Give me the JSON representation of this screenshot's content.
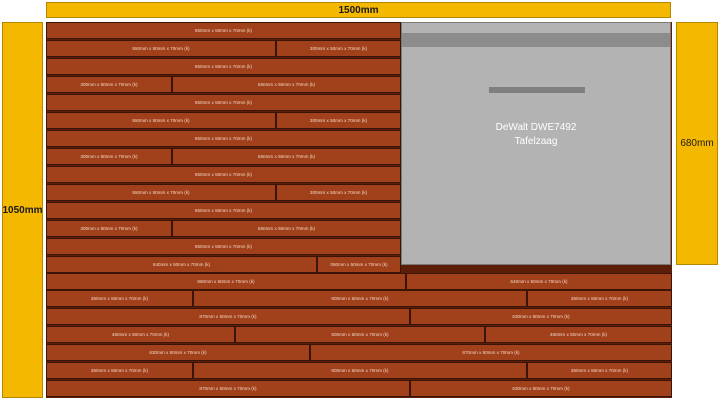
{
  "dimensions": {
    "width": "1500mm",
    "height": "1050mm",
    "table_saw_depth": "680mm"
  },
  "table_saw": {
    "line1": "DeWalt DWE7492",
    "line2": "Tafelzaag"
  },
  "rows": [
    [
      "850mm x 50mm x 70mm (k)"
    ],
    [
      "550mm x 50mm x 70mm (k)",
      "300mm x 50mm x 70mm (k)"
    ],
    [
      "850mm x 50mm x 70mm (k)"
    ],
    [
      "300mm x 50mm x 70mm (k)",
      "550mm x 50mm x 70mm (k)"
    ],
    [
      "850mm x 50mm x 70mm (k)"
    ],
    [
      "550mm x 50mm x 70mm (k)",
      "300mm x 50mm x 70mm (k)"
    ],
    [
      "850mm x 50mm x 70mm (k)"
    ],
    [
      "300mm x 50mm x 70mm (k)",
      "550mm x 50mm x 70mm (k)"
    ],
    [
      "850mm x 50mm x 70mm (k)"
    ],
    [
      "550mm x 50mm x 70mm (k)",
      "300mm x 50mm x 70mm (k)"
    ],
    [
      "850mm x 50mm x 70mm (k)"
    ],
    [
      "300mm x 50mm x 70mm (k)",
      "550mm x 50mm x 70mm (k)"
    ],
    [
      "850mm x 50mm x 70mm (k)"
    ],
    [
      "640mm x 50mm x 70mm (k)",
      "060mm x 50mm x 70mm (k)"
    ],
    [
      "860mm x 50mm x 70mm (k)",
      "640mm x 50mm x 70mm (k)"
    ],
    [
      "350mm x 50mm x 70mm (k)",
      "800mm x 50mm x 70mm (k)",
      "350mm x 50mm x 70mm (k)"
    ],
    [
      "870mm x 50mm x 70mm (k)",
      "630mm x 50mm x 70mm (k)"
    ],
    [
      "450mm x 50mm x 70mm (k)",
      "600mm x 50mm x 70mm (k)",
      "450mm x 50mm x 70mm (k)"
    ],
    [
      "630mm x 50mm x 70mm (k)",
      "870mm x 50mm x 70mm (k)"
    ],
    [
      "350mm x 50mm x 70mm (k)",
      "800mm x 50mm x 70mm (k)",
      "350mm x 50mm x 70mm (k)"
    ],
    [
      "870mm x 50mm x 70mm (k)",
      "630mm x 50mm x 70mm (k)"
    ]
  ]
}
